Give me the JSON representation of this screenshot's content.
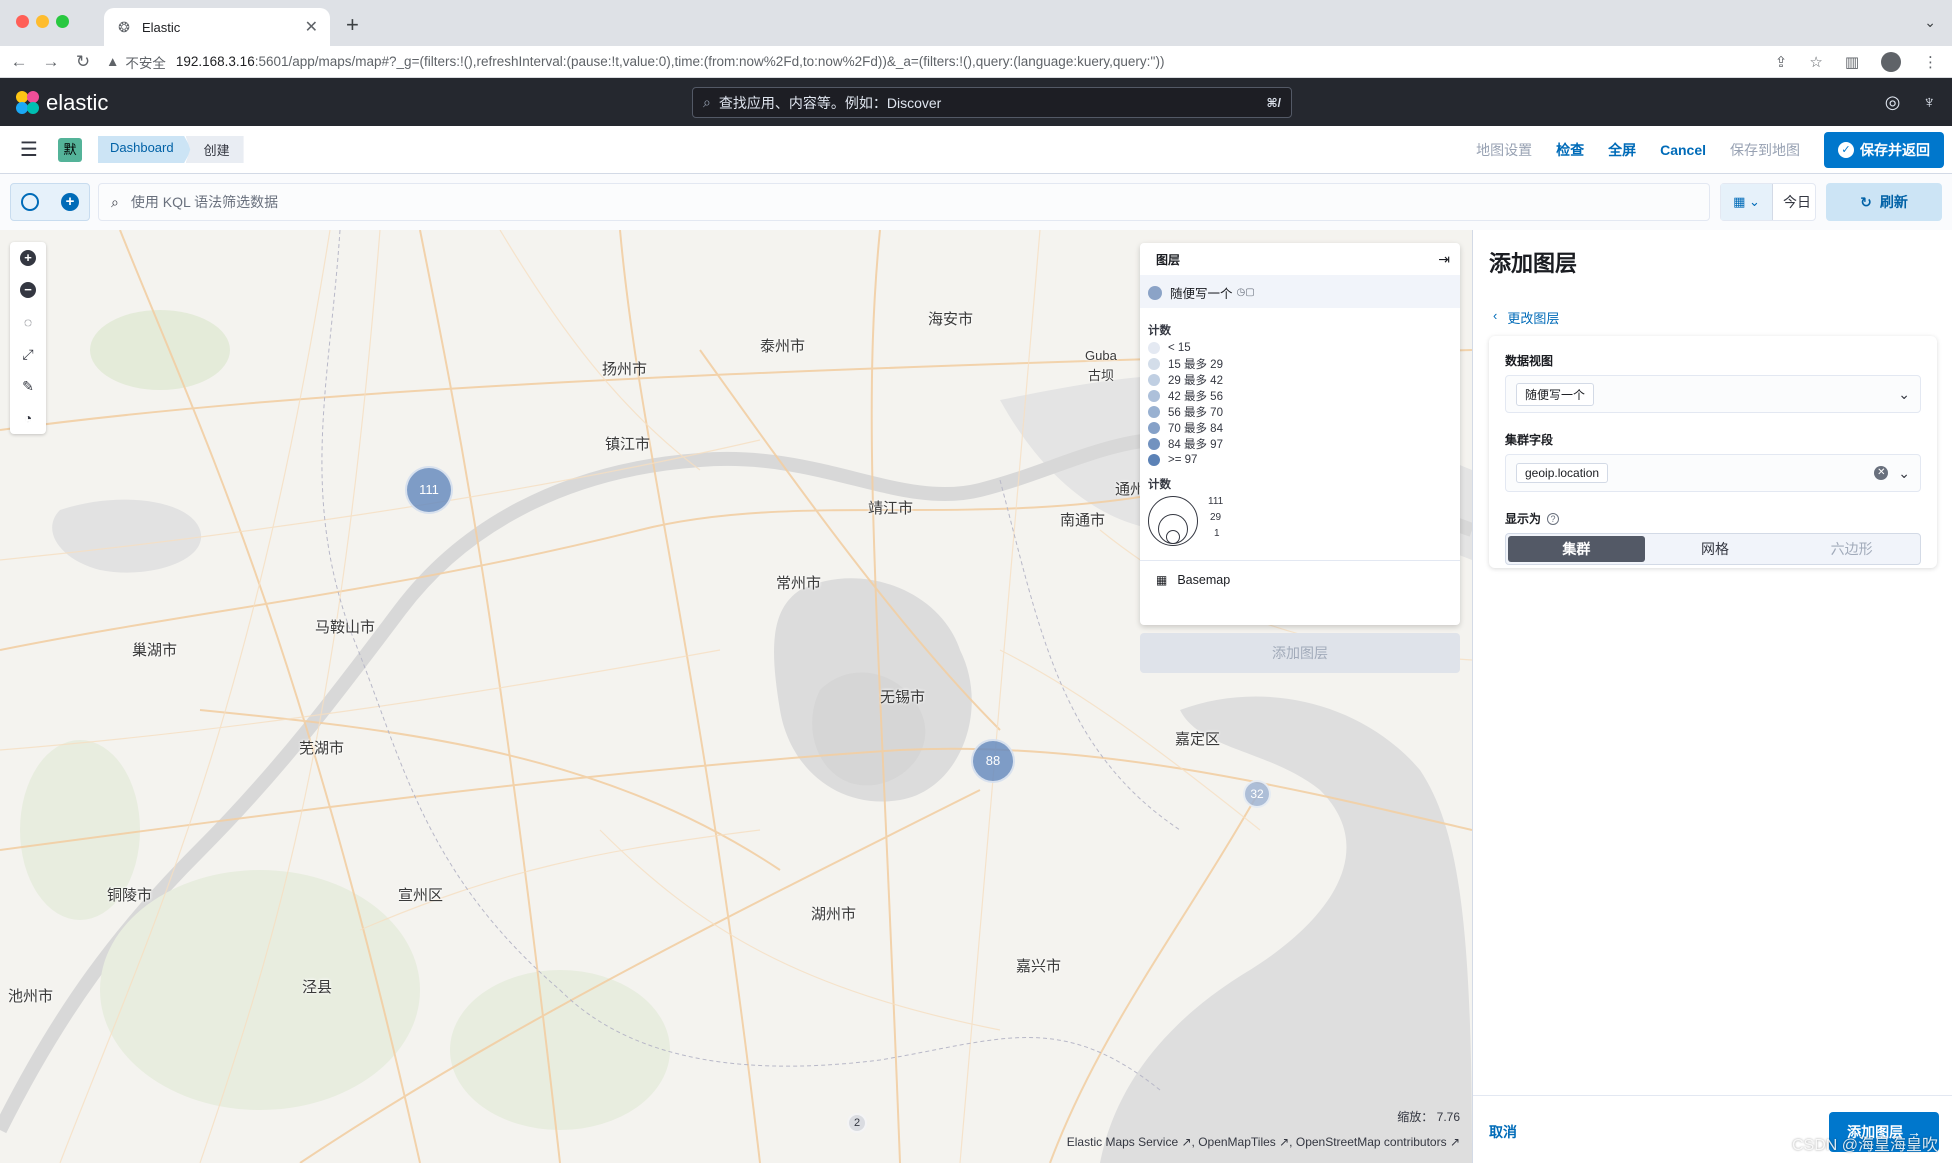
{
  "browser": {
    "tab_title": "Elastic",
    "url_warning": "不安全",
    "url_host": "192.168.3.16",
    "url_rest": ":5601/app/maps/map#?_g=(filters:!(),refreshInterval:(pause:!t,value:0),time:(from:now%2Fd,to:now%2Fd))&_a=(filters:!(),query:(language:kuery,query:''))"
  },
  "header": {
    "logo_text": "elastic",
    "search_placeholder": "查找应用、内容等。例如：Discover",
    "search_shortcut": "⌘/"
  },
  "subheader": {
    "space_badge": "默",
    "breadcrumbs": [
      "Dashboard",
      "创建"
    ],
    "links": {
      "map_settings": "地图设置",
      "inspect": "检查",
      "fullscreen": "全屏",
      "cancel": "Cancel",
      "save_to_map": "保存到地图",
      "save_and_return": "保存并返回"
    }
  },
  "querybar": {
    "kql_placeholder": "使用 KQL 语法筛选数据",
    "date_label": "今日",
    "refresh_label": "刷新"
  },
  "map": {
    "labels": [
      {
        "text": "海安市"
      },
      {
        "text": "泰州市"
      },
      {
        "text": "扬州市"
      },
      {
        "text": "Guba"
      },
      {
        "text": "古坝"
      },
      {
        "text": "镇江市"
      },
      {
        "text": "通州"
      },
      {
        "text": "靖江市"
      },
      {
        "text": "南通市"
      },
      {
        "text": "常州市"
      },
      {
        "text": "马鞍山市"
      },
      {
        "text": "巢湖市"
      },
      {
        "text": "无锡市"
      },
      {
        "text": "嘉定区"
      },
      {
        "text": "芜湖市"
      },
      {
        "text": "铜陵市"
      },
      {
        "text": "宣州区"
      },
      {
        "text": "湖州市"
      },
      {
        "text": "嘉兴市"
      },
      {
        "text": "池州市"
      },
      {
        "text": "泾县"
      }
    ],
    "clusters": [
      {
        "count": "111"
      },
      {
        "count": "88"
      },
      {
        "count": "32"
      },
      {
        "count": "2"
      }
    ],
    "zoom_label": "缩放：",
    "zoom_value": "7.76",
    "attribution": [
      "Elastic Maps Service",
      "OpenMapTiles",
      "OpenStreetMap contributors"
    ]
  },
  "toc": {
    "title": "图层",
    "layer_name": "随便写一个",
    "legend_title": "计数",
    "legend_rows": [
      {
        "label": "< 15",
        "color": "#e4e9f2"
      },
      {
        "label": "15 最多 29",
        "color": "#d3dde9"
      },
      {
        "label": "29 最多 42",
        "color": "#c0cfe2"
      },
      {
        "label": "42 最多 56",
        "color": "#adc0da"
      },
      {
        "label": "56 最多 70",
        "color": "#99b1d1"
      },
      {
        "label": "70 最多 84",
        "color": "#85a1c8"
      },
      {
        "label": "84 最多 97",
        "color": "#7292bf"
      },
      {
        "label": ">= 97",
        "color": "#5c82b6"
      }
    ],
    "size_legend_title": "计数",
    "size_legend": [
      "111",
      "29",
      "1"
    ],
    "basemap": "Basemap",
    "add_layer": "添加图层"
  },
  "panel": {
    "title": "添加图层",
    "back": "更改图层",
    "data_view_label": "数据视图",
    "data_view_value": "随便写一个",
    "cluster_field_label": "集群字段",
    "cluster_field_value": "geoip.location",
    "display_as_label": "显示为",
    "display_options": [
      "集群",
      "网格",
      "六边形"
    ],
    "cancel": "取消",
    "add_layer": "添加图层"
  },
  "watermark": "CSDN @海皇海皇吹"
}
